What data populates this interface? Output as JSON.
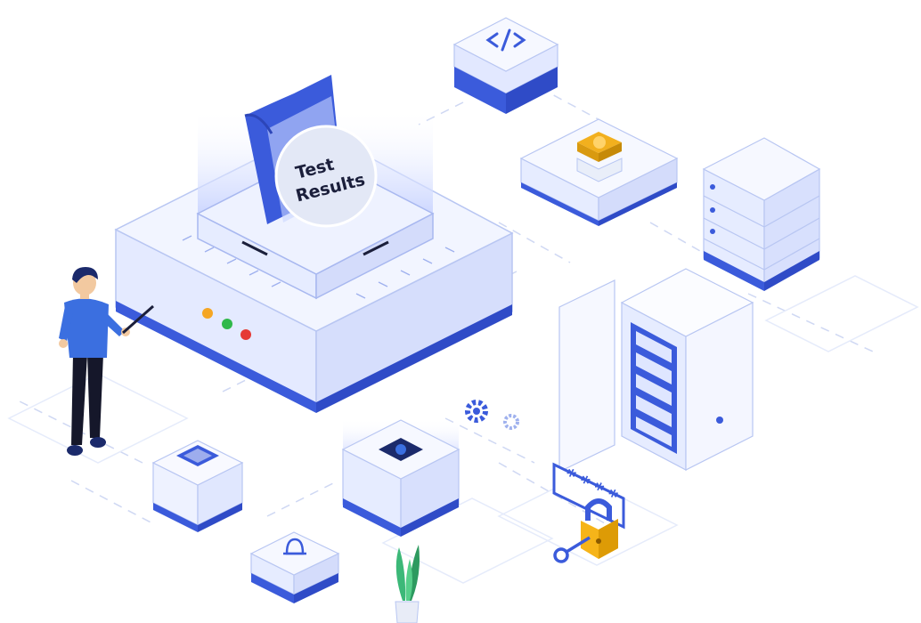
{
  "illustration": {
    "badge_line1": "Test",
    "badge_line2": "Results",
    "password_mask": "* * * *"
  },
  "icons": [
    "code-icon",
    "dollar-coin-icon",
    "server-rack-icon",
    "server-cabinet-icon",
    "gear-icon",
    "cpu-chip-icon",
    "bell-icon",
    "padlock-icon",
    "key-icon",
    "plant-icon",
    "person-icon",
    "status-lights-icon"
  ],
  "colors": {
    "primary_blue": "#3b5bdb",
    "light_blue": "#dfe6ff",
    "pale_blue": "#eef2ff",
    "coin_yellow": "#f2b01e",
    "lock_yellow": "#f6b419",
    "light_orange": "#f5a623",
    "light_green": "#2fb84a",
    "light_red": "#e53935",
    "plant_green": "#3cb878",
    "skin": "#f2c9a0",
    "shirt": "#3b6fe0",
    "dark": "#1b1f3b"
  }
}
